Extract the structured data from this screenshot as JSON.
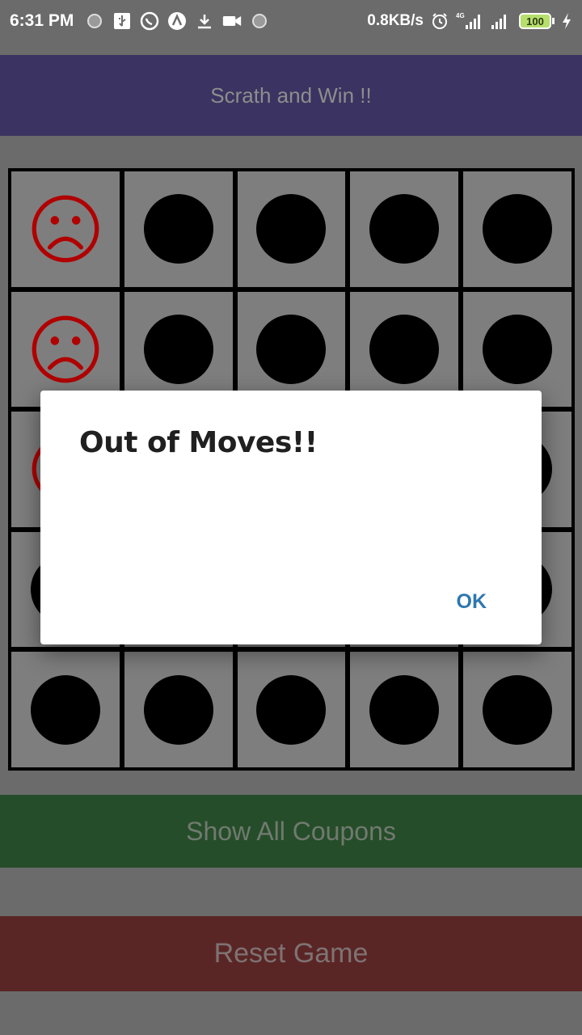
{
  "status_bar": {
    "time": "6:31 PM",
    "net_speed": "0.8KB/s",
    "network_type": "4G",
    "battery": "100",
    "icons": [
      "circle-icon",
      "usb-icon",
      "whatsapp-icon",
      "app-a-icon",
      "download-icon",
      "video-icon",
      "circle-icon",
      "alarm-icon",
      "signal-icon",
      "signal-icon",
      "charging-icon"
    ]
  },
  "title_bar": {
    "title": "Scrath and Win !!"
  },
  "grid": {
    "rows": 5,
    "columns": 5,
    "cells": [
      [
        "sad",
        "hidden",
        "hidden",
        "hidden",
        "hidden"
      ],
      [
        "sad",
        "hidden",
        "hidden",
        "hidden",
        "hidden"
      ],
      [
        "sad",
        "hidden",
        "hidden",
        "hidden",
        "hidden"
      ],
      [
        "hidden",
        "hidden",
        "hidden",
        "hidden",
        "hidden"
      ],
      [
        "hidden",
        "hidden",
        "hidden",
        "hidden",
        "hidden"
      ]
    ],
    "sad_color": "#b00000"
  },
  "buttons": {
    "show_coupons": "Show All Coupons",
    "reset_game": "Reset Game"
  },
  "dialog": {
    "title": "Out of Moves!!",
    "ok_label": "OK"
  },
  "colors": {
    "title_bar": "#3b3361",
    "coupons_button": "#264d29",
    "reset_button": "#5a2625",
    "ok_text": "#2f77b0"
  }
}
